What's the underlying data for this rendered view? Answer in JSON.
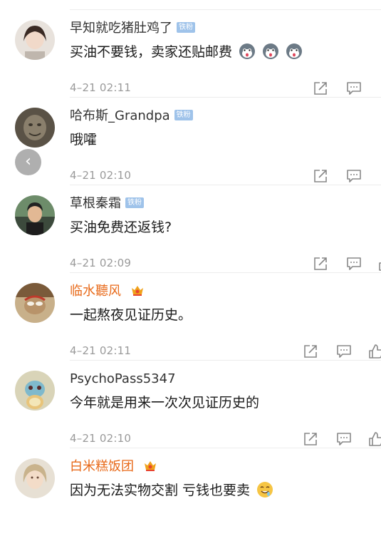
{
  "comments": [
    {
      "username": "早知就吃猪肚鸡了",
      "badge": "铁粉",
      "text": "买油不要钱，卖家还贴邮费",
      "emoji_count": 3,
      "time": "4–21 02:11"
    },
    {
      "username": "哈布斯_Grandpa",
      "badge": "铁粉",
      "text": "哦嚯",
      "time": "4–21 02:10"
    },
    {
      "username": "草根秦霜",
      "badge": "铁粉",
      "text": "买油免费还返钱?",
      "time": "4–21 02:09"
    },
    {
      "username": "临水聽风",
      "text": "一起熬夜见证历史。",
      "time": "4–21 02:11"
    },
    {
      "username": "PsychoPass5347",
      "text": "今年就是用来一次次见证历史的",
      "time": "4–21 02:10"
    },
    {
      "username": "白米糕饭团",
      "text": "因为无法实物交割 亏钱也要卖",
      "time": ""
    }
  ],
  "colors": {
    "vip_name": "#e86a1a",
    "badge_bg": "#9fc3ea",
    "muted": "#9a9a9a"
  },
  "icons": {
    "back": "chevron-left-icon",
    "share": "share-icon",
    "comment": "comment-icon",
    "like": "thumbs-up-icon"
  },
  "back_glyph": "‹"
}
